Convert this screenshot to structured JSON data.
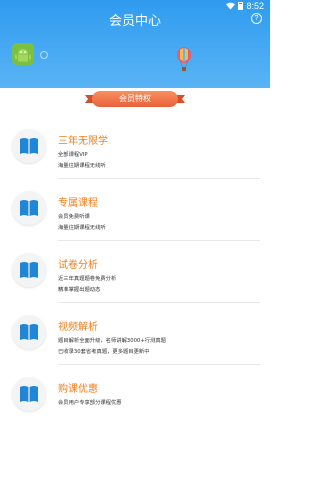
{
  "status_bar": {
    "time": "8:52"
  },
  "header": {
    "title": "会员中心",
    "help": "?"
  },
  "badge": {
    "label": "会员特权"
  },
  "features": [
    {
      "title": "三年无限学",
      "lines": [
        "全部课程VIP",
        "海量往期课程无线听"
      ]
    },
    {
      "title": "专属课程",
      "lines": [
        "会员免费听课",
        "海量往期课程无线听"
      ]
    },
    {
      "title": "试卷分析",
      "lines": [
        "近三年真题题卷免费分析",
        "精准掌握出题动态"
      ]
    },
    {
      "title": "视频解析",
      "lines": [
        "题目解析全面升级，名师讲解3000+行测真题",
        "已收录30套省考真题，更多题目更新中"
      ]
    },
    {
      "title": "购课优惠",
      "lines": [
        "会员用户专享部分课程优惠"
      ]
    }
  ],
  "colors": {
    "header_top": "#2f9bef",
    "header_bottom": "#59b4f5",
    "accent": "#f07f1f",
    "badge": "#ee6a40",
    "book_icon": "#1f86d8"
  }
}
